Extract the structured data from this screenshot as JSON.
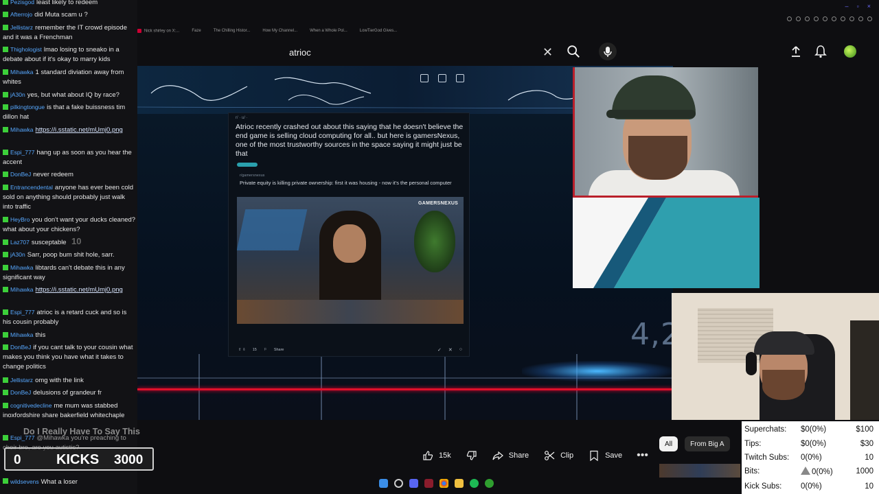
{
  "browser": {
    "bookmarks": [
      "Nick shirley on X:...",
      "Faze",
      "The Chilling Histor...",
      "How My Channel...",
      "When a Whole Pol...",
      "LowTierGod Gives..."
    ]
  },
  "youtube": {
    "search_value": "atrioc",
    "actions": {
      "like_count": "15k",
      "share_label": "Share",
      "clip_label": "Clip",
      "save_label": "Save"
    },
    "chips": [
      "All",
      "From Big A"
    ]
  },
  "video": {
    "post": {
      "title": "Atrioc recently crashed out about this saying that he doesn't believe the end game is selling cloud computing for all.. but here is gamersNexus, one of the most trustworthy sources in the space saying it might just be that",
      "link_title": "Private equity is killing private ownership: first it was housing - now it's the personal computer",
      "image_logo": "GAMERSNEXUS",
      "actions": [
        "15",
        "Share"
      ]
    },
    "overlay_number": "4,2"
  },
  "chat": {
    "messages": [
      {
        "user": "Pezisgod",
        "text": "least likely to redeem"
      },
      {
        "user": "Afterrojo",
        "text": "did Muta scam u ?"
      },
      {
        "user": "Jellistarz",
        "text": "remember the IT crowd episode and it was a Frenchman"
      },
      {
        "user": "Thighologist",
        "text": "lmao losing to sneako in a debate about if it's okay to marry kids"
      },
      {
        "user": "Mihawka",
        "text": "1 standard diviation away from whites"
      },
      {
        "user": "jA30n",
        "text": "yes, but what about IQ by race?"
      },
      {
        "user": "pilkingtongue",
        "text": "is that a fake buissness tim dillon hat"
      },
      {
        "user": "Mihawka",
        "text": "https://i.sstatic.net/mUmj0.png",
        "link": true
      },
      {
        "user": "Espi_777",
        "text": "hang up as soon as you hear the accent"
      },
      {
        "user": "DonBeJ",
        "text": "never redeem"
      },
      {
        "user": "Entrancendental",
        "text": "anyone has ever been cold sold on anything should probably just walk into traffic"
      },
      {
        "user": "HeyBro",
        "text": "you don't want your ducks cleaned? what about your chickens?"
      },
      {
        "user": "Laz707",
        "text": "susceptable"
      },
      {
        "user": "jA30n",
        "text": "Sarr, poop bum shit hole, sarr."
      },
      {
        "user": "Mihawka",
        "text": "libtards can't debate this in any significant way"
      },
      {
        "user": "Mihawka",
        "text": "https://i.sstatic.net/mUmj0.png",
        "link": true
      },
      {
        "user": "Espi_777",
        "text": "atrioc is a retard cuck and so is his cousin probably"
      },
      {
        "user": "Mihawka",
        "text": "this"
      },
      {
        "user": "DonBeJ",
        "text": "if you cant talk to your cousin what makes you think you have what it takes to change politics"
      },
      {
        "user": "Jellistarz",
        "text": "omg with the link"
      },
      {
        "user": "DonBeJ",
        "text": "delusions of grandeur fr"
      },
      {
        "user": "cognitivedecline",
        "text": "me mum was stabbed inoxfordshire share bakerfield whitechaple"
      },
      {
        "user": "Espi_777",
        "text": "@Mihawka you're preaching to choir bro, are you autistic?"
      },
      {
        "user": "wildsevens",
        "text": "What a loser"
      }
    ],
    "emote_count": "10"
  },
  "overlays": {
    "song_title": "Do I Really Have To Say This",
    "kicks_current": "0",
    "kicks_label": "KICKS",
    "kicks_goal": "3000"
  },
  "stats": [
    {
      "label": "Superchats:",
      "value": "$0(0%)",
      "goal": "$100"
    },
    {
      "label": "Tips:",
      "value": "$0(0%)",
      "goal": "$30"
    },
    {
      "label": "Twitch Subs:",
      "value": "0(0%)",
      "goal": "10"
    },
    {
      "label": "Bits:",
      "value": "0(0%)",
      "goal": "1000"
    },
    {
      "label": "Kick Subs:",
      "value": "0(0%)",
      "goal": "10"
    }
  ],
  "colors": {
    "chat_username": "#57a8ff",
    "sub_badge": "#3ccf3a",
    "progress_red": "#e0102a"
  }
}
